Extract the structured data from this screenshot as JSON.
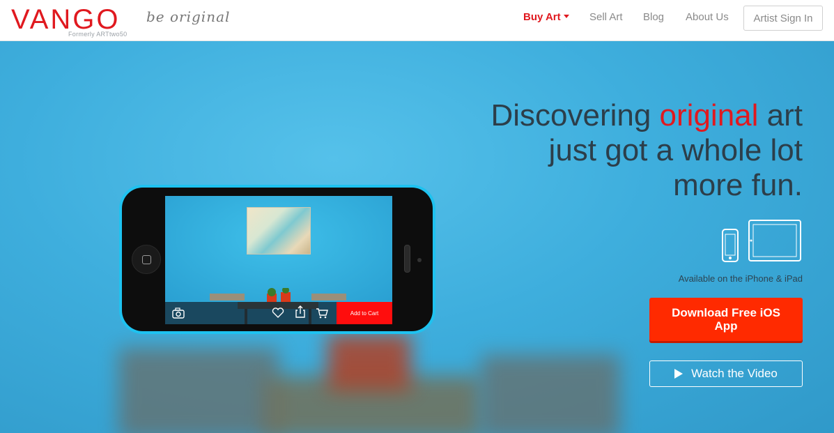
{
  "brand": {
    "logo": "VANGO",
    "formerly": "Formerly ARTtwo50",
    "tagline": "be original",
    "accent_color": "#e0191f"
  },
  "nav": {
    "buy_art": "Buy Art",
    "sell_art": "Sell Art",
    "blog": "Blog",
    "about_us": "About Us",
    "artist_sign_in": "Artist Sign In"
  },
  "hero": {
    "headline_pre": "Discovering ",
    "headline_highlight": "original",
    "headline_post": " art",
    "headline_line2": "just got a whole lot",
    "headline_line3": "more fun.",
    "availability": "Available on the iPhone & iPad",
    "download_button": "Download Free iOS App",
    "video_button": "Watch the Video",
    "download_color": "#ff2a00"
  },
  "phone_screen": {
    "add_to_cart": "Add to Cart",
    "icons": [
      "camera-icon",
      "heart-icon",
      "share-icon",
      "cart-icon"
    ]
  }
}
